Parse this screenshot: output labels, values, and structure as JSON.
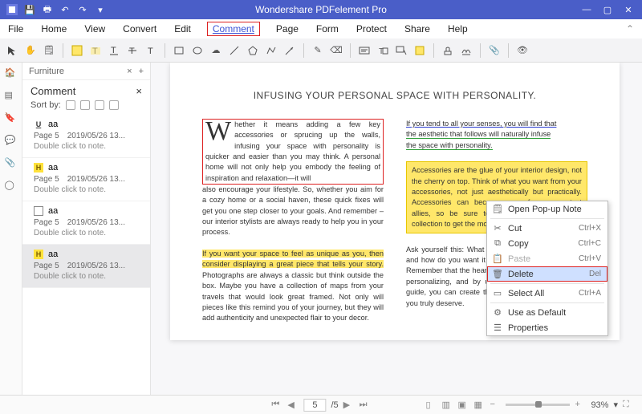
{
  "titlebar": {
    "app": "Wondershare PDFelement Pro"
  },
  "menu": {
    "items": [
      "File",
      "Home",
      "View",
      "Convert",
      "Edit",
      "Comment",
      "Page",
      "Form",
      "Protect",
      "Share",
      "Help"
    ],
    "active_index": 5
  },
  "tabs": {
    "name": "Furniture"
  },
  "panel": {
    "title": "Comment",
    "sort_label": "Sort by:",
    "comments": [
      {
        "badge": "U",
        "badgeType": "u",
        "author": "aa",
        "page": "Page 5",
        "date": "2019/05/26 13...",
        "note": "Double click to note."
      },
      {
        "badge": "H",
        "badgeType": "h",
        "author": "aa",
        "page": "Page 5",
        "date": "2019/05/26 13...",
        "note": "Double click to note."
      },
      {
        "badge": "",
        "badgeType": "box",
        "author": "aa",
        "page": "Page 5",
        "date": "2019/05/26 13...",
        "note": "Double click to note."
      },
      {
        "badge": "H",
        "badgeType": "h",
        "author": "aa",
        "page": "Page 5",
        "date": "2019/05/26 13...",
        "note": "Double click to note."
      }
    ],
    "selected_index": 3
  },
  "document": {
    "heading": "INFUSING YOUR PERSONAL SPACE WITH PERSONALITY.",
    "left": {
      "p1a": "Whether it means adding a few key accessories or sprucing up the walls, infusing your space with personality is quicker and easier than you may think. A personal home will not only help you embody the feeling of inspiration and relaxation—it will",
      "p1b": "also encourage your lifestyle. So, whether you aim for a cozy home or a social haven, these quick fixes will get you one step closer to your goals. And remember – our interior stylists are always ready to help you in your process.",
      "p2a": "If you want your space to feel as unique as you, then consider displaying a great piece that tells your story.",
      "p2b": " Photographs are always a classic but think outside the box. Maybe you have a collection of maps from your travels that would look great framed. Not only will pieces like this remind you of your journey, but they will add authenticity and unexpected flair to your decor."
    },
    "right": {
      "u1": "If you tend to all your senses, you will find that",
      "u2": "the aesthetic that follows will naturally infuse",
      "u3": "the space with personality.",
      "box": "Accessories are the glue of your interior design, not the cherry on top. Think of what you want from your accessories, not just aesthetically but practically. Accessories can become one of your greatest allies, so be sure to rethink your accessories collection to get the most out of your space.",
      "p3a": "Ask yourself this: What do you want from your space and how do you want it to make you and others feel? Remember that the heart knows best when it comes to personalizing, and by using these quick fixes as a guide, you can create the oasis of inspired living that you truly deserve."
    }
  },
  "context_menu": {
    "items": [
      {
        "icon": "note",
        "label": "Open Pop-up Note",
        "key": ""
      },
      {
        "icon": "cut",
        "label": "Cut",
        "key": "Ctrl+X"
      },
      {
        "icon": "copy",
        "label": "Copy",
        "key": "Ctrl+C"
      },
      {
        "icon": "paste",
        "label": "Paste",
        "key": "Ctrl+V",
        "disabled": true
      },
      {
        "icon": "trash",
        "label": "Delete",
        "key": "Del",
        "selected": true
      },
      {
        "icon": "selall",
        "label": "Select All",
        "key": "Ctrl+A"
      },
      {
        "icon": "default",
        "label": "Use as Default",
        "key": ""
      },
      {
        "icon": "props",
        "label": "Properties",
        "key": ""
      }
    ]
  },
  "status": {
    "page_current": "5",
    "page_total": "/5",
    "zoom": "93%"
  }
}
